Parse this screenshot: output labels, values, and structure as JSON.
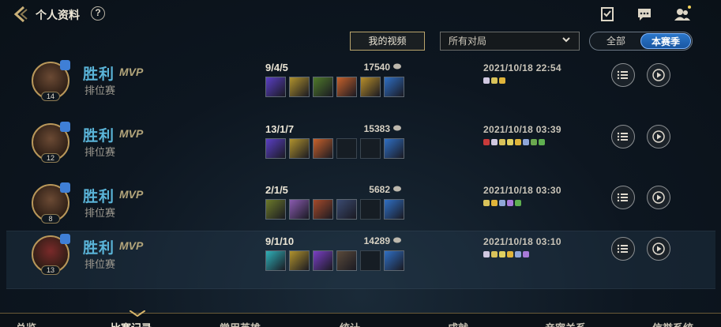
{
  "header": {
    "title": "个人资料",
    "help_label": "?"
  },
  "filters": {
    "my_video_label": "我的视频",
    "match_filter_value": "所有对局",
    "seg_all_label": "全部",
    "seg_season_label": "本赛季"
  },
  "matches": [
    {
      "result": "胜利",
      "mvp": "MVP",
      "mode": "排位赛",
      "level": "14",
      "kda": "9/4/5",
      "gold": "17540",
      "date": "2021/10/18 22:54",
      "item_colors": [
        "#5a3fc4",
        "#b0922d",
        "#4f7a2a",
        "#c7612b",
        "#b78e2a",
        "#2f6fc4"
      ],
      "badge_colors": [
        "#d0c8e0",
        "#d8c25a",
        "#e0b43a"
      ]
    },
    {
      "result": "胜利",
      "mvp": "MVP",
      "mode": "排位赛",
      "level": "12",
      "kda": "13/1/7",
      "gold": "15383",
      "date": "2021/10/18 03:39",
      "item_colors": [
        "#5a3fc4",
        "#b0922d",
        "#c7612b",
        "",
        "",
        "#2f6fc4"
      ],
      "badge_colors": [
        "#c83a3a",
        "#d0c8e0",
        "#d8c25a",
        "#e0d060",
        "#e0b43a",
        "#8fa6d8",
        "#6aa84f",
        "#5fb050"
      ]
    },
    {
      "result": "胜利",
      "mvp": "MVP",
      "mode": "排位赛",
      "level": "8",
      "kda": "2/1/5",
      "gold": "5682",
      "date": "2021/10/18 03:30",
      "item_colors": [
        "#6c7a2a",
        "#8a5bb0",
        "#a54a2a",
        "#3a4a70",
        "",
        "#2f6fc4"
      ],
      "badge_colors": [
        "#d8c25a",
        "#e0b43a",
        "#8fa6d8",
        "#a87ad8",
        "#5fb050"
      ]
    },
    {
      "result": "胜利",
      "mvp": "MVP",
      "mode": "排位赛",
      "level": "13",
      "kda": "9/1/10",
      "gold": "14289",
      "date": "2021/10/18 03:10",
      "item_colors": [
        "#2fb0b8",
        "#b0922d",
        "#7a3fc4",
        "#5a4a3a",
        "",
        "#2f6fc4"
      ],
      "badge_colors": [
        "#d0c8e0",
        "#d8c25a",
        "#e0d060",
        "#e0b43a",
        "#8fa6d8",
        "#a87ad8"
      ]
    }
  ],
  "bottom_nav": [
    "总览",
    "比赛记录",
    "常用英雄",
    "统计",
    "成就",
    "亲密关系",
    "信誉系统"
  ],
  "colors": {
    "accent_gold": "#b9a46c",
    "win_blue": "#5ab4d8",
    "season_blue": "#2b77c9"
  }
}
